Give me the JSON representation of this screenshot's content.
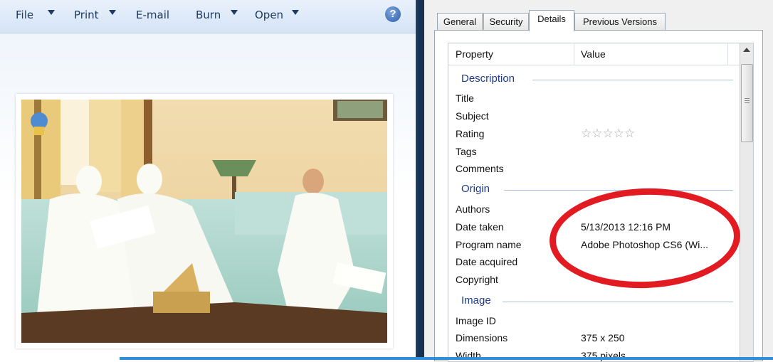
{
  "toolbar": {
    "file": "File",
    "print": "Print",
    "email": "E-mail",
    "burn": "Burn",
    "open": "Open",
    "help_icon": "?"
  },
  "photo": {
    "icon": "photo-of-meeting"
  },
  "tabs": [
    {
      "label": "General",
      "active": false
    },
    {
      "label": "Security",
      "active": false
    },
    {
      "label": "Details",
      "active": true
    },
    {
      "label": "Previous Versions",
      "active": false
    }
  ],
  "columns": {
    "property": "Property",
    "value": "Value"
  },
  "groups": {
    "description": "Description",
    "origin": "Origin",
    "image": "Image"
  },
  "rows": {
    "title": {
      "label": "Title",
      "value": ""
    },
    "subject": {
      "label": "Subject",
      "value": ""
    },
    "rating": {
      "label": "Rating",
      "value": "☆☆☆☆☆",
      "stars": 0
    },
    "tags": {
      "label": "Tags",
      "value": ""
    },
    "comments": {
      "label": "Comments",
      "value": ""
    },
    "authors": {
      "label": "Authors",
      "value": ""
    },
    "date_taken": {
      "label": "Date taken",
      "value": "5/13/2013 12:16 PM"
    },
    "program_name": {
      "label": "Program name",
      "value": "Adobe Photoshop CS6 (Wi..."
    },
    "date_acquired": {
      "label": "Date acquired",
      "value": ""
    },
    "copyright": {
      "label": "Copyright",
      "value": ""
    },
    "image_id": {
      "label": "Image ID",
      "value": ""
    },
    "dimensions": {
      "label": "Dimensions",
      "value": "375 x 250"
    },
    "width": {
      "label": "Width",
      "value": "375 pixels"
    }
  },
  "colors": {
    "highlight_circle": "#e21b23",
    "group_text": "#1e3c8c",
    "accent_strip": "#2f8fd8"
  }
}
